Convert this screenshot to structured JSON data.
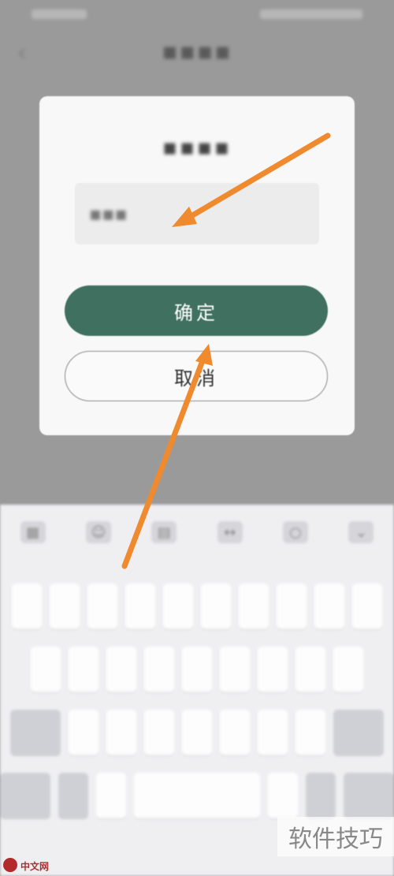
{
  "dialog": {
    "confirm_label": "确定",
    "cancel_label": "取消"
  },
  "watermark": {
    "logo_text": "中文网",
    "site_text": "软件技巧"
  },
  "colors": {
    "confirm_button": "#3f7060",
    "arrow": "#f08a2e",
    "dialog_bg": "#f8f8f8",
    "overlay": "#9a9a9a"
  },
  "icons": {
    "keyboard_toolbar": [
      "grid-icon",
      "emoji-icon",
      "clipboard-icon",
      "cursor-move-icon",
      "search-icon",
      "collapse-icon"
    ],
    "annotation": "orange-arrow-icon"
  }
}
